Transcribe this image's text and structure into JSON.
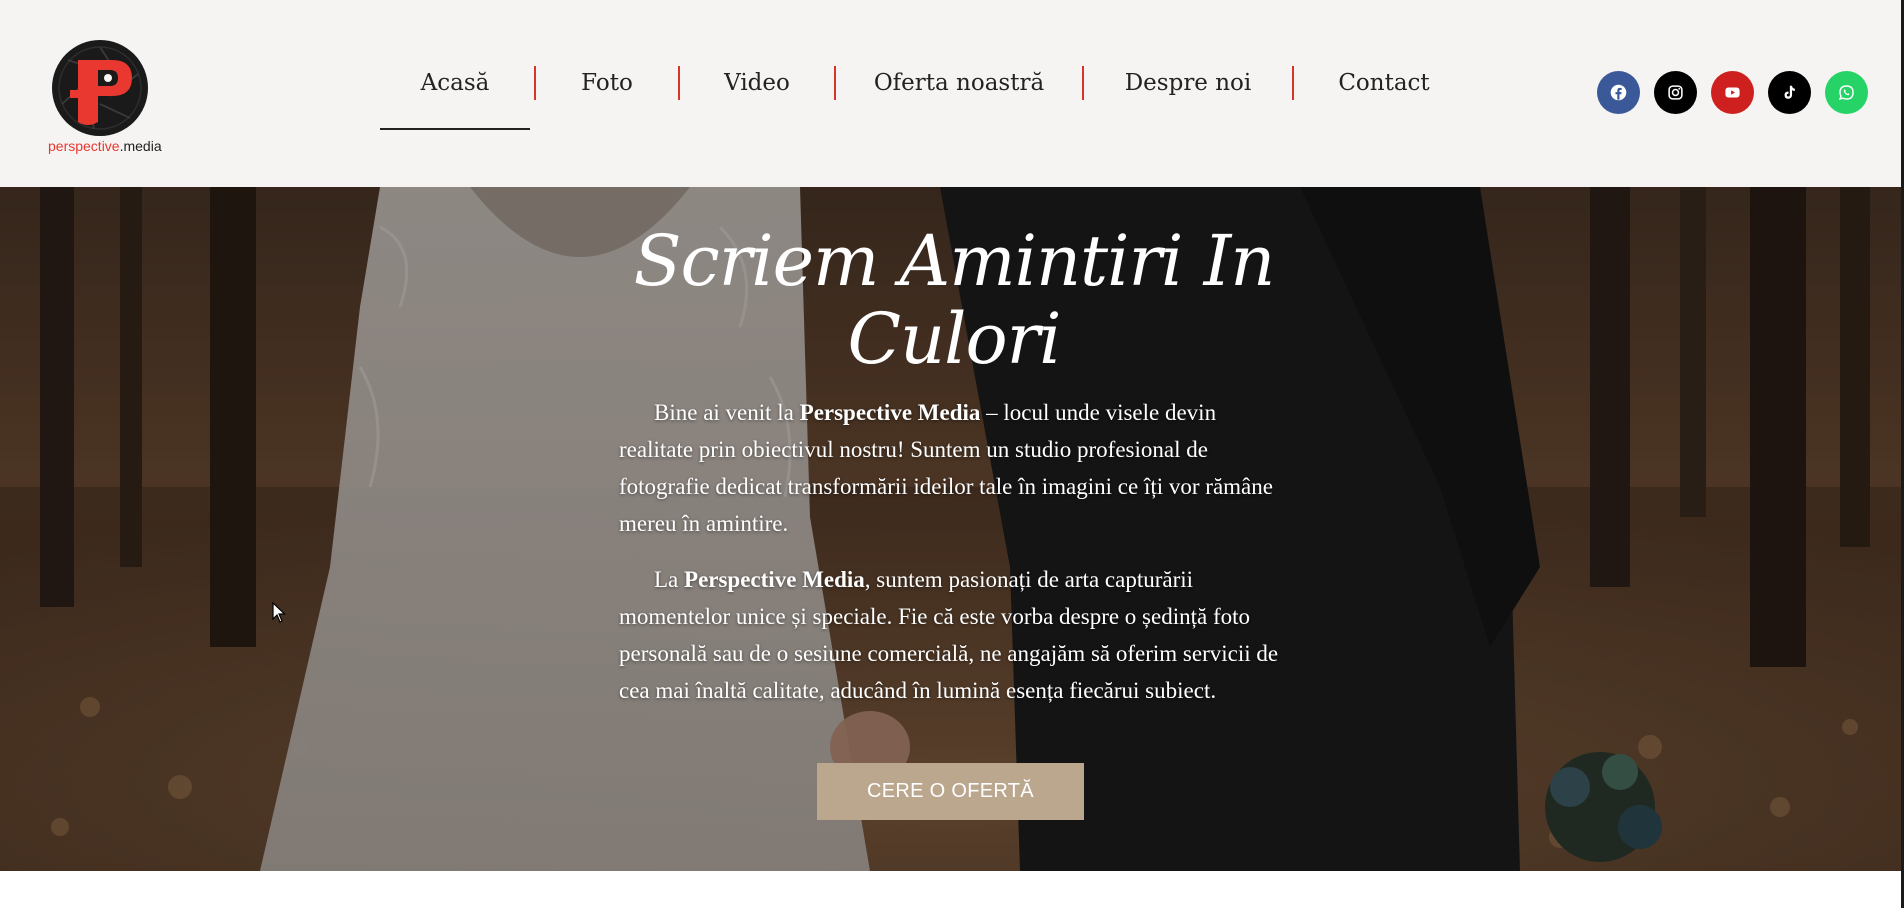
{
  "brand": {
    "name_part1": "perspective",
    "name_part2": ".media",
    "logo_icon": "camera-aperture-p-logo",
    "red": "#e8382f"
  },
  "nav": {
    "items": [
      {
        "label": "Acasă",
        "active": true
      },
      {
        "label": "Foto"
      },
      {
        "label": "Video"
      },
      {
        "label": "Oferta noastră"
      },
      {
        "label": "Despre noi"
      },
      {
        "label": "Contact"
      }
    ],
    "separator_color": "#d8342c"
  },
  "socials": [
    {
      "name": "facebook",
      "icon": "facebook-icon",
      "color": "#3b5998"
    },
    {
      "name": "instagram",
      "icon": "instagram-icon",
      "color": "#000000"
    },
    {
      "name": "youtube",
      "icon": "youtube-icon",
      "color": "#cd201f"
    },
    {
      "name": "tiktok",
      "icon": "tiktok-icon",
      "color": "#000000"
    },
    {
      "name": "whatsapp",
      "icon": "whatsapp-icon",
      "color": "#25d366"
    }
  ],
  "hero": {
    "title": "Scriem Amintiri In Culori",
    "para1": {
      "before": "Bine ai venit la ",
      "bold": "Perspective Media",
      "after": " – locul unde visele devin realitate prin obiectivul nostru! Suntem un studio profesional de fotografie dedicat transformării ideilor tale în imagini ce îți vor rămâne mereu în amintire."
    },
    "para2": {
      "before": "La ",
      "bold": "Perspective Media",
      "after": ", suntem pasionați de arta capturării momentelor unice și speciale. Fie că este vorba despre o ședință foto personală sau de o sesiune comercială, ne angajăm să oferim servicii de cea mai înaltă calitate, aducând în lumină esența fiecărui subiect."
    },
    "cta_label": "CERE O OFERTĂ",
    "cta_color": "#bba78e",
    "background_image": "wedding-couple-forest-photo"
  },
  "colors": {
    "header_bg": "#f6f4f2",
    "text_dark": "#222222"
  }
}
